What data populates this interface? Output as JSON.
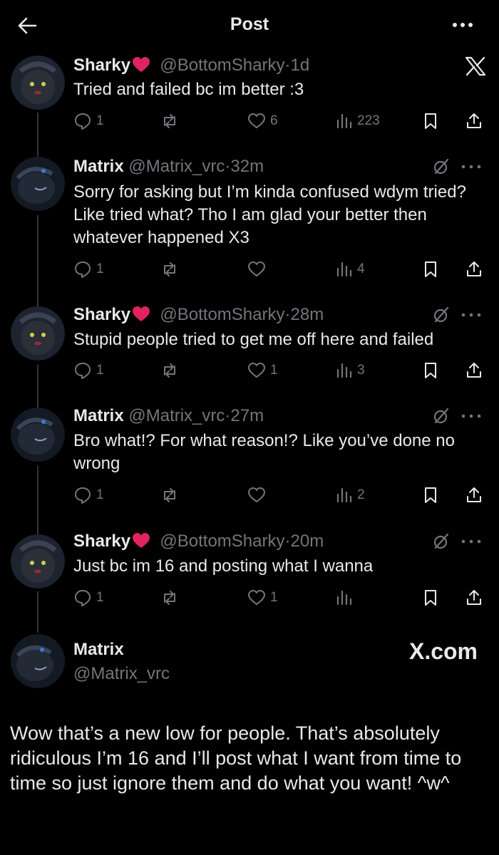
{
  "header": {
    "title": "Post"
  },
  "colors": {
    "background": "#000000",
    "text": "#e7e9ea",
    "muted": "#71767b",
    "heart": "#e0245e"
  },
  "tweets": [
    {
      "name": "Sharky",
      "has_heart": true,
      "handle": "@BottomSharky",
      "time": "1d",
      "text": "Tried and failed bc im better :3",
      "replies": "1",
      "reposts": "",
      "likes": "6",
      "views": "223",
      "top_icon": "x-logo-icon"
    },
    {
      "name": "Matrix",
      "has_heart": false,
      "handle": "@Matrix_vrc",
      "time": "32m",
      "text": "Sorry for asking but I’m kinda confused wdym tried? Like tried what? Tho I am glad your better then whatever happened X3",
      "replies": "1",
      "reposts": "",
      "likes": "",
      "views": "4",
      "top_icon": "grok-icon"
    },
    {
      "name": "Sharky",
      "has_heart": true,
      "handle": "@BottomSharky",
      "time": "28m",
      "text": "Stupid people tried to get me off here and failed",
      "replies": "1",
      "reposts": "",
      "likes": "1",
      "views": "3",
      "top_icon": "grok-icon"
    },
    {
      "name": "Matrix",
      "has_heart": false,
      "handle": "@Matrix_vrc",
      "time": "27m",
      "text": "Bro what!? For what reason!? Like you’ve done no wrong",
      "replies": "1",
      "reposts": "",
      "likes": "",
      "views": "2",
      "top_icon": "grok-icon"
    },
    {
      "name": "Sharky",
      "has_heart": true,
      "handle": "@BottomSharky",
      "time": "20m",
      "text": "Just bc im 16 and posting what I wanna",
      "replies": "1",
      "reposts": "",
      "likes": "1",
      "views": "",
      "top_icon": "grok-icon"
    }
  ],
  "final_post": {
    "name": "Matrix",
    "handle": "@Matrix_vrc",
    "watermark": "X.com",
    "text": "Wow that’s a new low for people. That’s absolutely ridiculous I’m 16 and I’ll post what I want from time to time so just ignore them and do what you want! ^w^"
  }
}
